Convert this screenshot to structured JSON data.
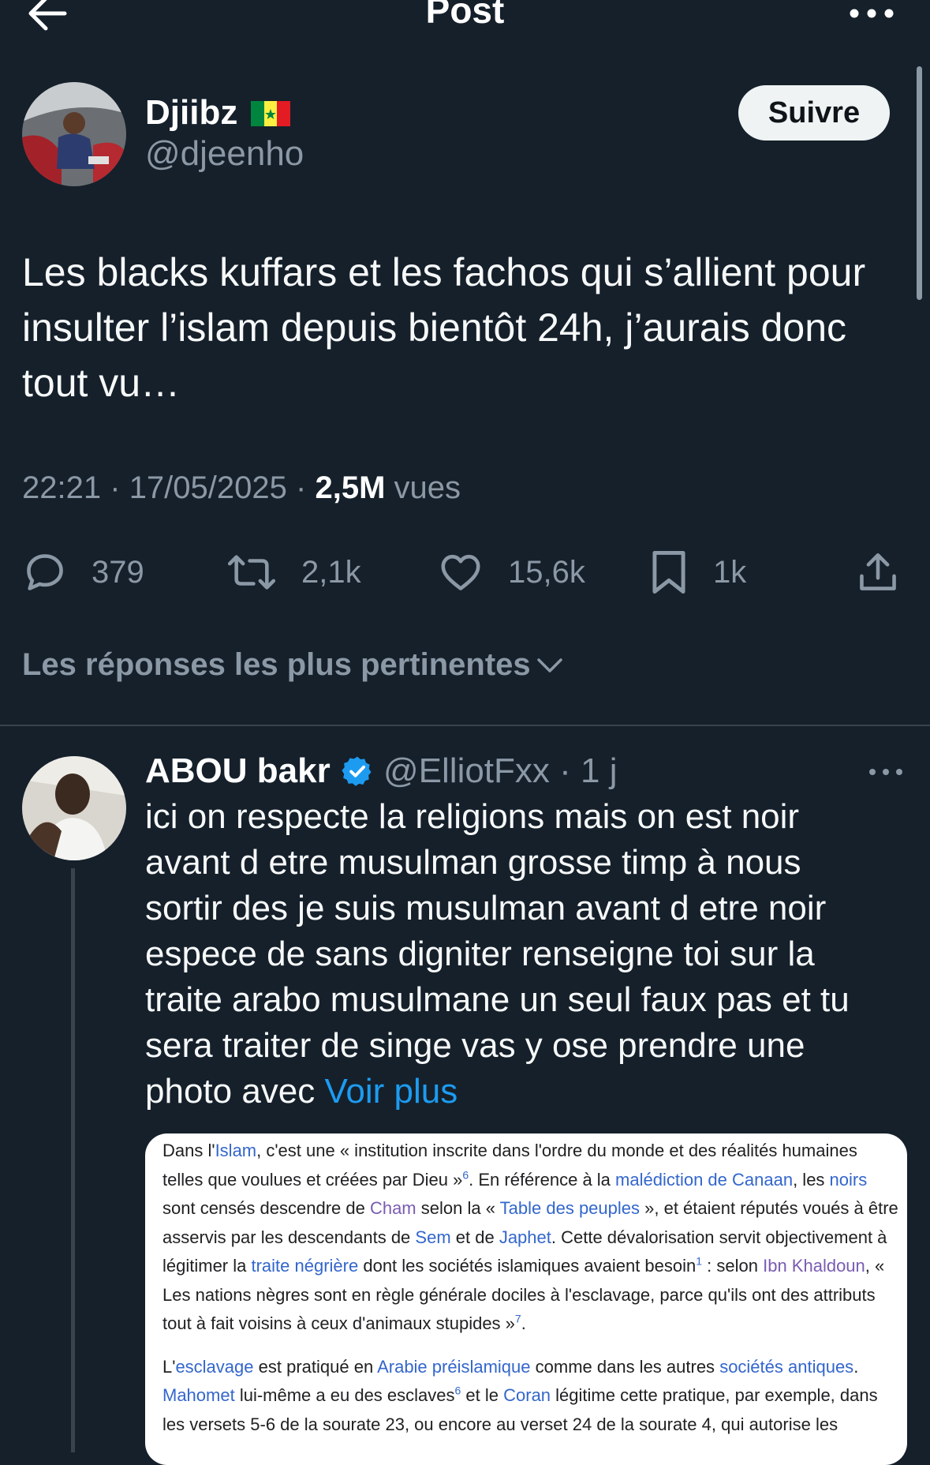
{
  "header": {
    "title": "Post",
    "back_icon": "arrow-left-icon",
    "more_icon": "more-horizontal-icon"
  },
  "post": {
    "author_name": "Djiibz",
    "author_flag": "senegal-flag-icon",
    "author_handle": "@djeenho",
    "follow_label": "Suivre",
    "text": "Les blacks kuffars et les fachos qui s’allient pour insulter l’islam depuis bientôt 24h, j’aurais donc tout vu…",
    "time": "22:21",
    "date": "17/05/2025",
    "sep": "·",
    "views_count": "2,5M",
    "views_label": "vues"
  },
  "actions": {
    "replies": "379",
    "reposts": "2,1k",
    "likes": "15,6k",
    "bookmarks": "1k"
  },
  "sort": {
    "label": "Les réponses les plus pertinentes"
  },
  "reply": {
    "name": "ABOU bakr",
    "handle": "@ElliotFxx",
    "time": "· 1 j",
    "text": "ici on respecte la religions mais on est noir avant d etre musulman grosse timp  à nous sortir des je suis musulman avant d etre noir espece de sans digniter renseigne toi sur la traite arabo musulmane un seul faux pas et tu sera traiter de singe vas y ose prendre une photo avec ",
    "more_link": "Voir plus"
  },
  "wiki": {
    "p1": [
      {
        "t": "Dans l'"
      },
      {
        "t": "Islam",
        "c": "link"
      },
      {
        "t": ", c'est une « institution inscrite dans l'ordre du monde et des réalités humaines telles que voulues et créées par Dieu »"
      },
      {
        "t": "6",
        "c": "sup"
      },
      {
        "t": ". En référence à la "
      },
      {
        "t": "malédiction de Canaan",
        "c": "link"
      },
      {
        "t": ", les "
      },
      {
        "t": "noirs",
        "c": "link"
      },
      {
        "t": " sont censés descendre de "
      },
      {
        "t": "Cham",
        "c": "visited"
      },
      {
        "t": " selon la « "
      },
      {
        "t": "Table des peuples",
        "c": "link"
      },
      {
        "t": " », et étaient réputés voués à être asservis par les descendants de "
      },
      {
        "t": "Sem",
        "c": "link"
      },
      {
        "t": " et de "
      },
      {
        "t": "Japhet",
        "c": "link"
      },
      {
        "t": ". Cette dévalorisation servit objectivement à légitimer la "
      },
      {
        "t": "traite négrière",
        "c": "link"
      },
      {
        "t": " dont les sociétés islamiques avaient besoin"
      },
      {
        "t": "1",
        "c": "sup"
      },
      {
        "t": " : selon "
      },
      {
        "t": "Ibn Khaldoun",
        "c": "visited"
      },
      {
        "t": ", « Les nations nègres sont en règle générale dociles à l'esclavage, parce qu'ils ont des attributs tout à fait voisins à ceux d'animaux stupides »"
      },
      {
        "t": "7",
        "c": "sup"
      },
      {
        "t": "."
      }
    ],
    "p2": [
      {
        "t": "L'"
      },
      {
        "t": "esclavage",
        "c": "link"
      },
      {
        "t": " est pratiqué en "
      },
      {
        "t": "Arabie préislamique",
        "c": "link"
      },
      {
        "t": " comme dans les autres "
      },
      {
        "t": "sociétés antiques",
        "c": "link"
      },
      {
        "t": ". "
      },
      {
        "t": "Mahomet",
        "c": "link"
      },
      {
        "t": " lui-même a eu des esclaves"
      },
      {
        "t": "6",
        "c": "sup"
      },
      {
        "t": " et le "
      },
      {
        "t": "Coran",
        "c": "link"
      },
      {
        "t": " légitime cette pratique, par exemple, dans les versets 5-6 de la sourate 23, ou encore au verset 24 de la sourate 4, qui autorise les"
      }
    ]
  },
  "colors": {
    "background": "#15202b",
    "accent": "#1d9bf0",
    "muted": "#8b98a5"
  }
}
